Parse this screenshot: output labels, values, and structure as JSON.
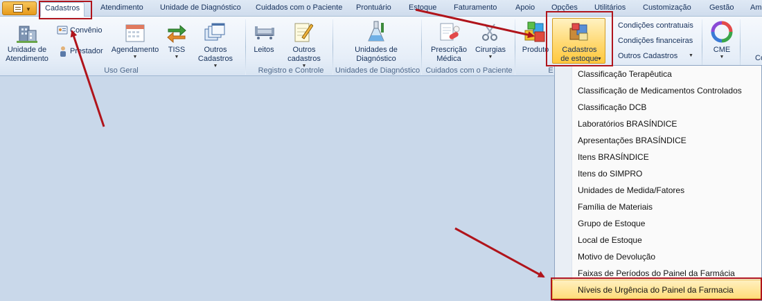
{
  "tabs": [
    "Cadastros",
    "Atendimento",
    "Unidade de Diagnóstico",
    "Cuidados com o Paciente",
    "Prontuário",
    "Estoque",
    "Faturamento",
    "Apoio",
    "Opções",
    "Utilitários",
    "Customização",
    "Gestão",
    "Amb"
  ],
  "active_tab": "Cadastros",
  "ribbon": {
    "uso_geral": {
      "label": "Uso Geral",
      "unidade_line1": "Unidade de",
      "unidade_line2": "Atendimento",
      "convenio": "Convênio",
      "prestador": "Prestador",
      "agendamento": "Agendamento",
      "tiss": "TISS",
      "outros_line1": "Outros",
      "outros_line2": "Cadastros"
    },
    "registro": {
      "label": "Registro e Controle",
      "leitos": "Leitos",
      "outros_line1": "Outros",
      "outros_line2": "cadastros"
    },
    "diagnostico": {
      "label": "Unidades de Diagnóstico",
      "unidades_line1": "Unidades de",
      "unidades_line2": "Diagnóstico"
    },
    "cuidados": {
      "label": "Cuidados com o Paciente",
      "prescricao_line1": "Prescrição",
      "prescricao_line2": "Médica",
      "cirurgias": "Cirurgias"
    },
    "estoque": {
      "label_fragment": "E",
      "produto": "Produto",
      "cadastros_line1": "Cadastros",
      "cadastros_line2": "de estoque"
    },
    "contratos": {
      "condicoes_contratuais": "Condições contratuais",
      "condicoes_financeiras": "Condições financeiras",
      "outros_cadastros": "Outros Cadastros"
    },
    "cme": {
      "label": "CME"
    },
    "edge_fragment": "Co"
  },
  "menu": {
    "items": [
      "Classificação Terapêutica",
      "Classificação de Medicamentos Controlados",
      "Classificação DCB",
      "Laboratórios BRASÍNDICE",
      "Apresentações BRASÍNDICE",
      "Itens BRASÍNDICE",
      "Itens do SIMPRO",
      "Unidades de Medida/Fatores",
      "Família de Materiais",
      "Grupo de Estoque",
      "Local de Estoque",
      "Motivo de Devolução",
      "Faixas de Períodos do Painel da Farmácia",
      "Níveis de Urgência do Painel da Farmacia"
    ],
    "highlighted_index": 13
  },
  "colors": {
    "annotation_red": "#b0141b",
    "hover_yellow": "#ffd973",
    "ribbon_blue": "#dde8f5"
  }
}
